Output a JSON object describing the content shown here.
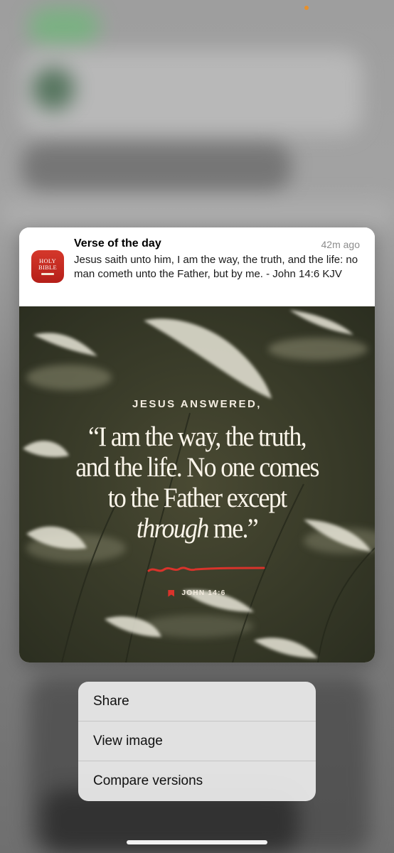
{
  "notification": {
    "app_icon_text": "HOLY BIBLE",
    "title": "Verse of the day",
    "time": "42m ago",
    "body": "Jesus saith unto him, I am the way, the truth, and the life: no man cometh unto the Father, but by me. - John 14:6 KJV"
  },
  "image": {
    "header": "JESUS ANSWERED,",
    "quote_part1": "“I am the way, the truth, and the life. No one comes to the Father except",
    "quote_emphasis": "through",
    "quote_part2": "me.”",
    "reference": "JOHN 14:6"
  },
  "menu": {
    "items": [
      {
        "label": "Share"
      },
      {
        "label": "View image"
      },
      {
        "label": "Compare versions"
      }
    ]
  },
  "colors": {
    "app_icon": "#c62a22",
    "accent_red": "#d9332b",
    "indicator_dot": "#e8902a"
  }
}
